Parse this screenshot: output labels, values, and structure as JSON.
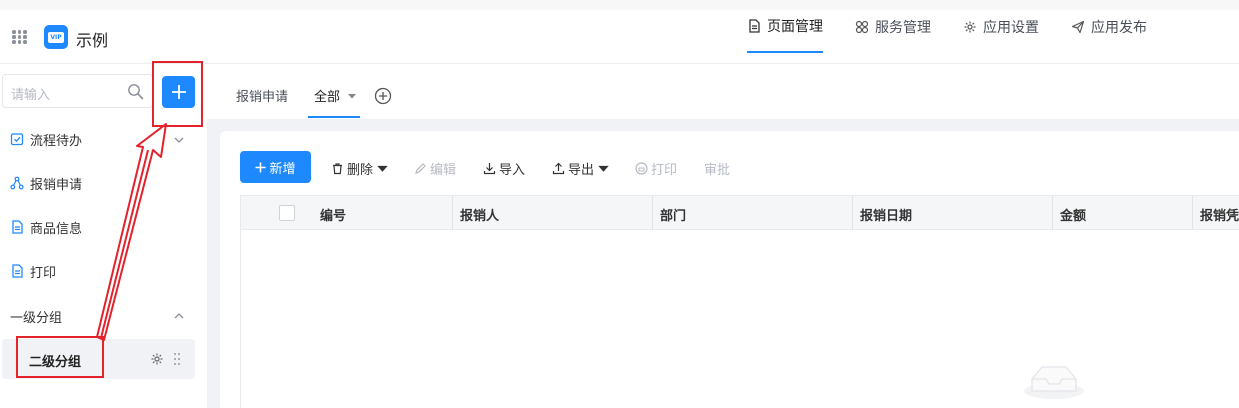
{
  "app": {
    "title": "示例",
    "logo_text": "VIP"
  },
  "top_nav": [
    {
      "label": "页面管理",
      "icon": "page-icon",
      "active": true
    },
    {
      "label": "服务管理",
      "icon": "services-icon",
      "active": false
    },
    {
      "label": "应用设置",
      "icon": "gear-icon",
      "active": false
    },
    {
      "label": "应用发布",
      "icon": "send-icon",
      "active": false
    }
  ],
  "sidebar": {
    "search_placeholder": "请输入",
    "items": [
      {
        "label": "流程待办",
        "icon": "checklist-icon"
      },
      {
        "label": "报销申请",
        "icon": "flow-icon"
      },
      {
        "label": "商品信息",
        "icon": "document-icon"
      },
      {
        "label": "打印",
        "icon": "document-icon"
      }
    ],
    "group": {
      "label": "一级分组",
      "sub_item": "二级分组"
    }
  },
  "tabs": [
    {
      "label": "报销申请",
      "active": false
    },
    {
      "label": "全部",
      "active": true
    }
  ],
  "toolbar": {
    "new": "新增",
    "delete": "删除",
    "edit": "编辑",
    "import": "导入",
    "export": "导出",
    "print": "打印",
    "approve": "审批"
  },
  "table": {
    "columns": [
      "编号",
      "报销人",
      "部门",
      "报销日期",
      "金额",
      "报销凭"
    ]
  },
  "colors": {
    "accent": "#1e88ff",
    "highlight": "#e3222b"
  }
}
